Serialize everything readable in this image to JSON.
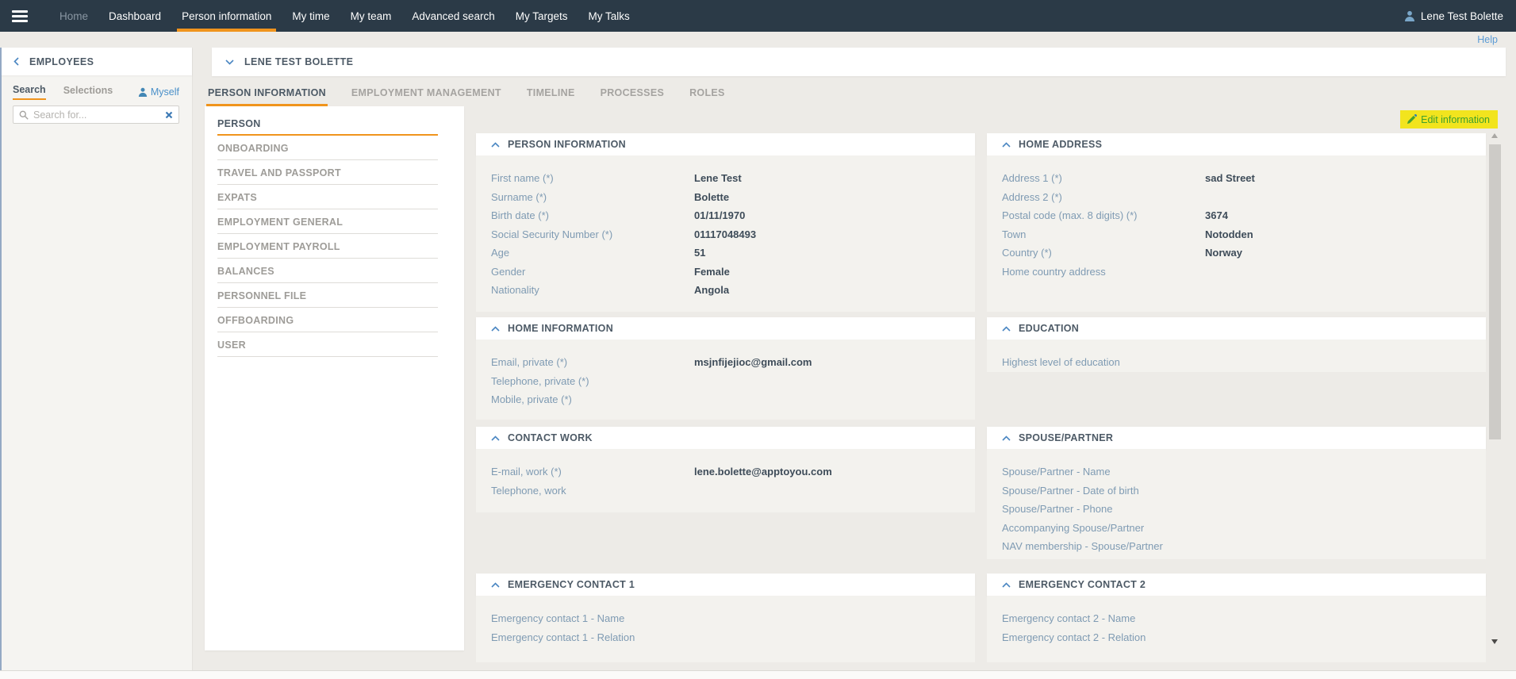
{
  "navbar": {
    "items": [
      {
        "label": "Home"
      },
      {
        "label": "Dashboard"
      },
      {
        "label": "Person information"
      },
      {
        "label": "My time"
      },
      {
        "label": "My team"
      },
      {
        "label": "Advanced search"
      },
      {
        "label": "My Targets"
      },
      {
        "label": "My Talks"
      }
    ],
    "active_item": "Person information",
    "user_name": "Lene Test Bolette"
  },
  "help_label": "Help",
  "sidebar": {
    "back_label": "EMPLOYEES",
    "tabs": [
      {
        "label": "Search"
      },
      {
        "label": "Selections"
      }
    ],
    "active_tab": "Search",
    "myself_label": "Myself",
    "search_placeholder": "Search for..."
  },
  "person_header": "LENE TEST BOLETTE",
  "main_tabs": [
    {
      "label": "PERSON INFORMATION"
    },
    {
      "label": "EMPLOYMENT MANAGEMENT"
    },
    {
      "label": "TIMELINE"
    },
    {
      "label": "PROCESSES"
    },
    {
      "label": "ROLES"
    }
  ],
  "active_main_tab": "PERSON INFORMATION",
  "subnav": {
    "items": [
      {
        "label": "PERSON"
      },
      {
        "label": "ONBOARDING"
      },
      {
        "label": "TRAVEL AND PASSPORT"
      },
      {
        "label": "EXPATS"
      },
      {
        "label": "EMPLOYMENT GENERAL"
      },
      {
        "label": "EMPLOYMENT PAYROLL"
      },
      {
        "label": "BALANCES"
      },
      {
        "label": "PERSONNEL FILE"
      },
      {
        "label": "OFFBOARDING"
      },
      {
        "label": "USER"
      }
    ],
    "active_item": "PERSON"
  },
  "edit_button_label": "Edit information",
  "colors": {
    "navbar_bg": "#2b3a47",
    "accent_orange": "#f0941d",
    "link_blue": "#4a90c9",
    "label_blue_gray": "#7f9bb3",
    "value_dark": "#3e4c59",
    "edit_highlight_yellow": "#f2e41e",
    "edit_text_green": "#3da02e"
  },
  "cards": {
    "left": [
      {
        "title": "PERSON INFORMATION",
        "fields": [
          {
            "label": "First name (*)",
            "value": "Lene Test"
          },
          {
            "label": "Surname (*)",
            "value": "Bolette"
          },
          {
            "label": "Birth date (*)",
            "value": "01/11/1970"
          },
          {
            "label": "Social Security Number (*)",
            "value": "01117048493"
          },
          {
            "label": "Age",
            "value": "51"
          },
          {
            "label": "Gender",
            "value": "Female"
          },
          {
            "label": "Nationality",
            "value": "Angola"
          }
        ]
      },
      {
        "title": "HOME INFORMATION",
        "fields": [
          {
            "label": "Email, private (*)",
            "value": "msjnfijejioc@gmail.com"
          },
          {
            "label": "Telephone, private (*)",
            "value": ""
          },
          {
            "label": "Mobile, private (*)",
            "value": ""
          }
        ]
      },
      {
        "title": "CONTACT WORK",
        "fields": [
          {
            "label": "E-mail, work (*)",
            "value": "lene.bolette@apptoyou.com"
          },
          {
            "label": "Telephone, work",
            "value": ""
          }
        ]
      },
      {
        "title": "EMERGENCY CONTACT 1",
        "fields": [
          {
            "label": "Emergency contact 1 - Name",
            "value": ""
          },
          {
            "label": "Emergency contact 1 - Relation",
            "value": ""
          }
        ]
      }
    ],
    "right": [
      {
        "title": "HOME ADDRESS",
        "fields": [
          {
            "label": "Address 1 (*)",
            "value": "sad Street"
          },
          {
            "label": "Address 2 (*)",
            "value": ""
          },
          {
            "label": "Postal code (max. 8 digits) (*)",
            "value": "3674"
          },
          {
            "label": "Town",
            "value": "Notodden"
          },
          {
            "label": "Country (*)",
            "value": "Norway"
          },
          {
            "label": "Home country address",
            "value": ""
          }
        ]
      },
      {
        "title": "EDUCATION",
        "fields": [
          {
            "label": "Highest level of education",
            "value": ""
          }
        ]
      },
      {
        "title": "SPOUSE/PARTNER",
        "fields": [
          {
            "label": "Spouse/Partner - Name",
            "value": ""
          },
          {
            "label": "Spouse/Partner - Date of birth",
            "value": ""
          },
          {
            "label": "Spouse/Partner - Phone",
            "value": ""
          },
          {
            "label": "Accompanying Spouse/Partner",
            "value": ""
          },
          {
            "label": "NAV membership - Spouse/Partner",
            "value": ""
          }
        ]
      },
      {
        "title": "EMERGENCY CONTACT 2",
        "fields": [
          {
            "label": "Emergency contact 2 - Name",
            "value": ""
          },
          {
            "label": "Emergency contact 2 - Relation",
            "value": ""
          }
        ]
      }
    ]
  }
}
